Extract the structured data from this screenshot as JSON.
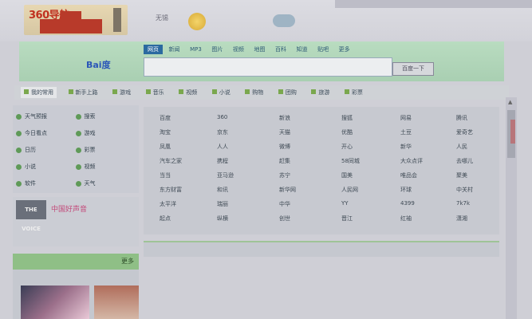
{
  "header": {
    "logo_text": "360导航",
    "city": "无锡",
    "top_right": [
      "",
      "",
      ""
    ]
  },
  "search": {
    "tabs": [
      "网页",
      "新闻",
      "MP3",
      "图片",
      "视频",
      "地图",
      "百科",
      "知道",
      "贴吧",
      "更多"
    ],
    "engine": "Bai度",
    "button": "百度一下",
    "placeholder": ""
  },
  "nav": {
    "items": [
      "我的常用",
      "新手上路",
      "游戏",
      "音乐",
      "视频",
      "小说",
      "购物",
      "团购",
      "旅游",
      "彩票"
    ]
  },
  "left": {
    "cells": [
      "天气预报",
      "搜索",
      "今日看点",
      "游戏",
      "日历",
      "彩票",
      "小说",
      "视频",
      "软件",
      "天气"
    ],
    "banner": {
      "title": "中国好声音",
      "lines": [
        "",
        ""
      ]
    },
    "box_title": "",
    "box_more": "更多"
  },
  "grid": {
    "rows": [
      [
        "百度",
        "360",
        "新浪",
        "搜狐",
        "网易",
        "腾讯"
      ],
      [
        "淘宝",
        "京东",
        "天猫",
        "优酷",
        "土豆",
        "爱奇艺"
      ],
      [
        "凤凰",
        "人人",
        "微博",
        "开心",
        "新华",
        "人民"
      ],
      [
        "汽车之家",
        "携程",
        "赶集",
        "58同城",
        "大众点评",
        "去哪儿"
      ],
      [
        "当当",
        "亚马逊",
        "苏宁",
        "国美",
        "唯品会",
        "聚美"
      ],
      [
        "东方财富",
        "和讯",
        "新华网",
        "人民网",
        "环球",
        "中关村"
      ],
      [
        "太平洋",
        "瑞丽",
        "中华",
        "YY",
        "4399",
        "7k7k"
      ],
      [
        "起点",
        "纵横",
        "创世",
        "晋江",
        "红袖",
        "潇湘"
      ]
    ]
  },
  "bottom": {
    "title": "",
    "more": "",
    "rows": [
      [
        "",
        "",
        "",
        "",
        "",
        "",
        ""
      ],
      [
        "",
        "",
        "",
        "",
        "",
        "",
        ""
      ],
      [
        "",
        "",
        "",
        "",
        "",
        "",
        ""
      ],
      [
        "",
        "",
        "",
        "",
        "",
        "",
        ""
      ]
    ]
  }
}
